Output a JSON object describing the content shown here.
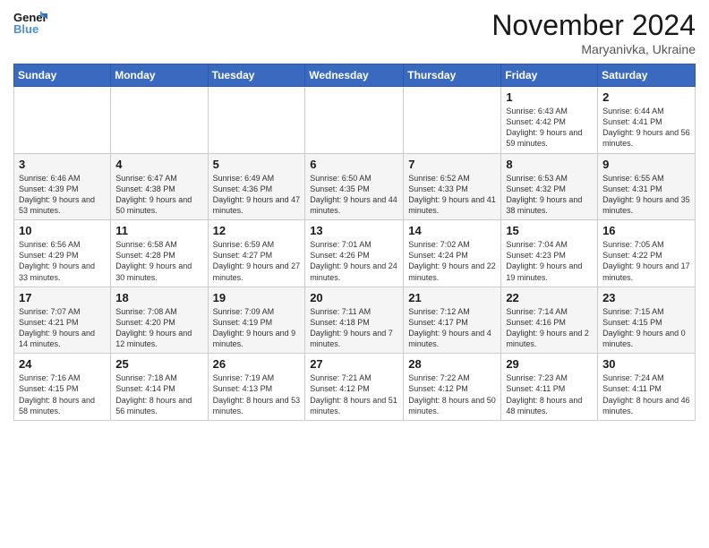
{
  "header": {
    "logo_general": "General",
    "logo_blue": "Blue",
    "month_title": "November 2024",
    "location": "Maryanivka, Ukraine"
  },
  "days_of_week": [
    "Sunday",
    "Monday",
    "Tuesday",
    "Wednesday",
    "Thursday",
    "Friday",
    "Saturday"
  ],
  "weeks": [
    [
      {
        "day": "",
        "info": ""
      },
      {
        "day": "",
        "info": ""
      },
      {
        "day": "",
        "info": ""
      },
      {
        "day": "",
        "info": ""
      },
      {
        "day": "",
        "info": ""
      },
      {
        "day": "1",
        "info": "Sunrise: 6:43 AM\nSunset: 4:42 PM\nDaylight: 9 hours and 59 minutes."
      },
      {
        "day": "2",
        "info": "Sunrise: 6:44 AM\nSunset: 4:41 PM\nDaylight: 9 hours and 56 minutes."
      }
    ],
    [
      {
        "day": "3",
        "info": "Sunrise: 6:46 AM\nSunset: 4:39 PM\nDaylight: 9 hours and 53 minutes."
      },
      {
        "day": "4",
        "info": "Sunrise: 6:47 AM\nSunset: 4:38 PM\nDaylight: 9 hours and 50 minutes."
      },
      {
        "day": "5",
        "info": "Sunrise: 6:49 AM\nSunset: 4:36 PM\nDaylight: 9 hours and 47 minutes."
      },
      {
        "day": "6",
        "info": "Sunrise: 6:50 AM\nSunset: 4:35 PM\nDaylight: 9 hours and 44 minutes."
      },
      {
        "day": "7",
        "info": "Sunrise: 6:52 AM\nSunset: 4:33 PM\nDaylight: 9 hours and 41 minutes."
      },
      {
        "day": "8",
        "info": "Sunrise: 6:53 AM\nSunset: 4:32 PM\nDaylight: 9 hours and 38 minutes."
      },
      {
        "day": "9",
        "info": "Sunrise: 6:55 AM\nSunset: 4:31 PM\nDaylight: 9 hours and 35 minutes."
      }
    ],
    [
      {
        "day": "10",
        "info": "Sunrise: 6:56 AM\nSunset: 4:29 PM\nDaylight: 9 hours and 33 minutes."
      },
      {
        "day": "11",
        "info": "Sunrise: 6:58 AM\nSunset: 4:28 PM\nDaylight: 9 hours and 30 minutes."
      },
      {
        "day": "12",
        "info": "Sunrise: 6:59 AM\nSunset: 4:27 PM\nDaylight: 9 hours and 27 minutes."
      },
      {
        "day": "13",
        "info": "Sunrise: 7:01 AM\nSunset: 4:26 PM\nDaylight: 9 hours and 24 minutes."
      },
      {
        "day": "14",
        "info": "Sunrise: 7:02 AM\nSunset: 4:24 PM\nDaylight: 9 hours and 22 minutes."
      },
      {
        "day": "15",
        "info": "Sunrise: 7:04 AM\nSunset: 4:23 PM\nDaylight: 9 hours and 19 minutes."
      },
      {
        "day": "16",
        "info": "Sunrise: 7:05 AM\nSunset: 4:22 PM\nDaylight: 9 hours and 17 minutes."
      }
    ],
    [
      {
        "day": "17",
        "info": "Sunrise: 7:07 AM\nSunset: 4:21 PM\nDaylight: 9 hours and 14 minutes."
      },
      {
        "day": "18",
        "info": "Sunrise: 7:08 AM\nSunset: 4:20 PM\nDaylight: 9 hours and 12 minutes."
      },
      {
        "day": "19",
        "info": "Sunrise: 7:09 AM\nSunset: 4:19 PM\nDaylight: 9 hours and 9 minutes."
      },
      {
        "day": "20",
        "info": "Sunrise: 7:11 AM\nSunset: 4:18 PM\nDaylight: 9 hours and 7 minutes."
      },
      {
        "day": "21",
        "info": "Sunrise: 7:12 AM\nSunset: 4:17 PM\nDaylight: 9 hours and 4 minutes."
      },
      {
        "day": "22",
        "info": "Sunrise: 7:14 AM\nSunset: 4:16 PM\nDaylight: 9 hours and 2 minutes."
      },
      {
        "day": "23",
        "info": "Sunrise: 7:15 AM\nSunset: 4:15 PM\nDaylight: 9 hours and 0 minutes."
      }
    ],
    [
      {
        "day": "24",
        "info": "Sunrise: 7:16 AM\nSunset: 4:15 PM\nDaylight: 8 hours and 58 minutes."
      },
      {
        "day": "25",
        "info": "Sunrise: 7:18 AM\nSunset: 4:14 PM\nDaylight: 8 hours and 56 minutes."
      },
      {
        "day": "26",
        "info": "Sunrise: 7:19 AM\nSunset: 4:13 PM\nDaylight: 8 hours and 53 minutes."
      },
      {
        "day": "27",
        "info": "Sunrise: 7:21 AM\nSunset: 4:12 PM\nDaylight: 8 hours and 51 minutes."
      },
      {
        "day": "28",
        "info": "Sunrise: 7:22 AM\nSunset: 4:12 PM\nDaylight: 8 hours and 50 minutes."
      },
      {
        "day": "29",
        "info": "Sunrise: 7:23 AM\nSunset: 4:11 PM\nDaylight: 8 hours and 48 minutes."
      },
      {
        "day": "30",
        "info": "Sunrise: 7:24 AM\nSunset: 4:11 PM\nDaylight: 8 hours and 46 minutes."
      }
    ]
  ]
}
